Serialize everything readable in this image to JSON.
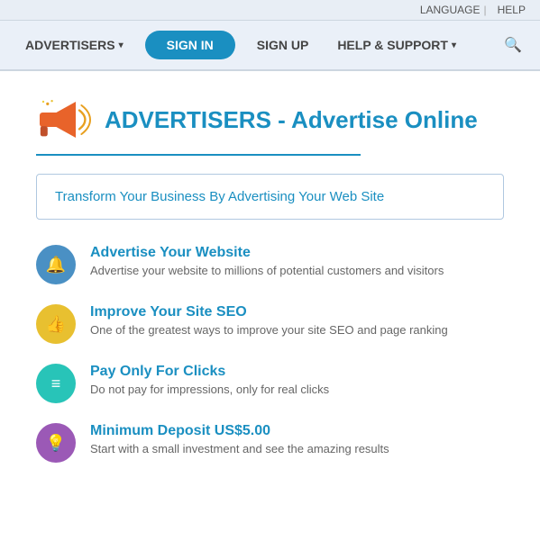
{
  "topbar": {
    "language_label": "LANGUAGE",
    "help_label": "HELP",
    "separator": "|"
  },
  "nav": {
    "advertisers_label": "ADVERTISERS",
    "signin_label": "SIGN IN",
    "signup_label": "SIGN UP",
    "help_label": "HELP & SUPPORT",
    "search_icon": "🔍"
  },
  "hero": {
    "title": "ADVERTISERS - Advertise Online",
    "tagline": "Transform Your Business By Advertising Your Web Site"
  },
  "features": [
    {
      "title": "Advertise Your Website",
      "desc": "Advertise your website to millions of potential customers and visitors",
      "icon_color": "icon-blue",
      "icon_symbol": "🔔"
    },
    {
      "title": "Improve Your Site SEO",
      "desc": "One of the greatest ways to improve your site SEO and page ranking",
      "icon_color": "icon-yellow",
      "icon_symbol": "👍"
    },
    {
      "title": "Pay Only For Clicks",
      "desc": "Do not pay for impressions, only for real clicks",
      "icon_color": "icon-teal",
      "icon_symbol": "≡"
    },
    {
      "title": "Minimum Deposit US$5.00",
      "desc": "Start with a small investment and see the amazing results",
      "icon_color": "icon-purple",
      "icon_symbol": "💡"
    }
  ]
}
